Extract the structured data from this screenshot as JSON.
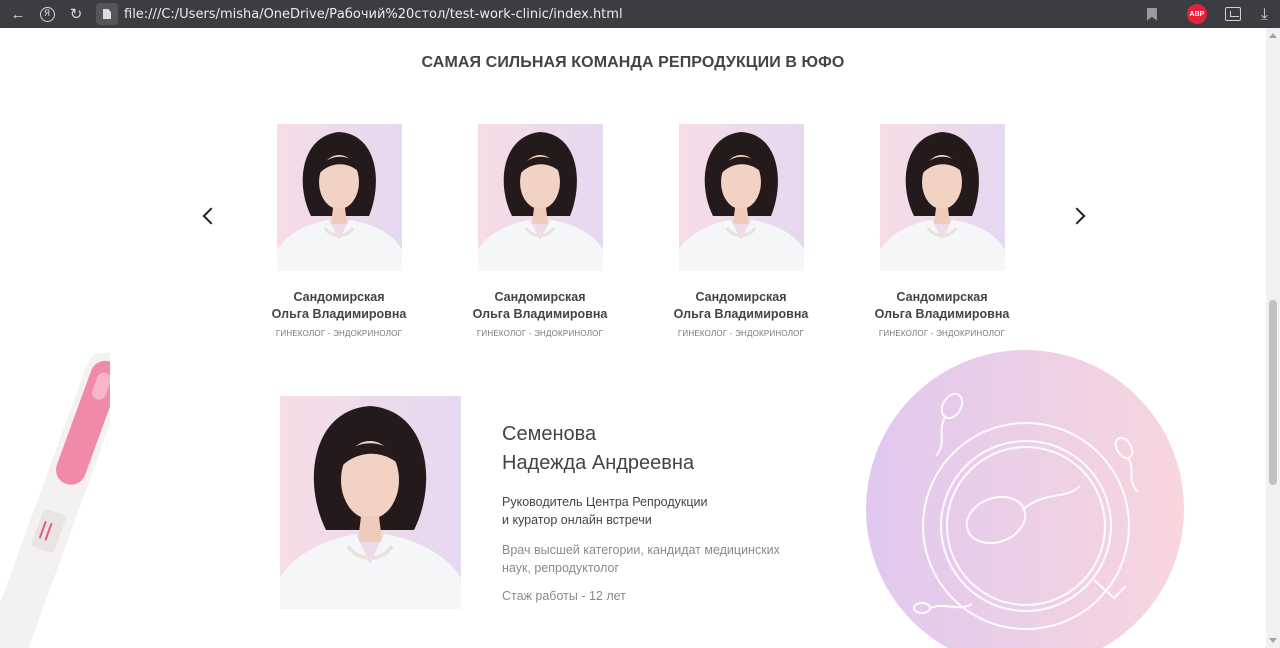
{
  "browser": {
    "url": "file:///C:/Users/misha/OneDrive/Рабочий%20стол/test-work-clinic/index.html",
    "yandex_label": "Я",
    "abp_label": "ABP"
  },
  "section": {
    "title": "САМАЯ СИЛЬНАЯ КОМАНДА РЕПРОДУКЦИИ В ЮФО"
  },
  "team": [
    {
      "surname": "Сандомирская",
      "given": "Ольга Владимировна",
      "role": "ГИНЕКОЛОГ - ЭНДОКРИНОЛОГ"
    },
    {
      "surname": "Сандомирская",
      "given": "Ольга Владимировна",
      "role": "ГИНЕКОЛОГ - ЭНДОКРИНОЛОГ"
    },
    {
      "surname": "Сандомирская",
      "given": "Ольга Владимировна",
      "role": "ГИНЕКОЛОГ - ЭНДОКРИНОЛОГ"
    },
    {
      "surname": "Сандомирская",
      "given": "Ольга Владимировна",
      "role": "ГИНЕКОЛОГ - ЭНДОКРИНОЛОГ"
    }
  ],
  "featured": {
    "surname": "Семенова",
    "given": "Надежда Андреевна",
    "role_line1": "Руководитель Центра Репродукции",
    "role_line2": "и куратор онлайн встречи",
    "desc_line1": "Врач высшей категории, кандидат медицинских",
    "desc_line2": "наук, репродуктолог",
    "experience": "Стаж работы - 12 лет"
  },
  "icons": {
    "back": "arrow-left-icon",
    "reload": "reload-icon",
    "bookmark": "bookmark-icon",
    "download": "download-icon",
    "prev": "chevron-left-icon",
    "next": "chevron-right-icon"
  },
  "colors": {
    "browser_bar": "#3c3d42",
    "text_dark": "#444444",
    "text_muted": "#8a8a8a",
    "photo_bg_pink": "#f6dde5",
    "photo_bg_lilac": "#e6d8f1",
    "decor_pink": "#f6d6de",
    "decor_lilac": "#e0c8ef"
  }
}
